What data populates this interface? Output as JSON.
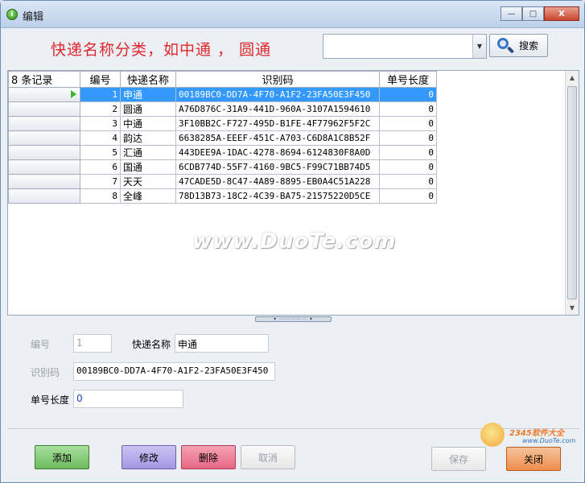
{
  "window": {
    "title": "编辑",
    "buttons": {
      "minimize": "—",
      "maximize": "□",
      "close": "X"
    }
  },
  "headline": "快递名称分类，如中通 ， 圆通",
  "search": {
    "value": "",
    "placeholder": "",
    "button_label": "搜索"
  },
  "grid": {
    "record_count_label": "8 条记录",
    "columns": [
      "编号",
      "快递名称",
      "识别码",
      "单号长度"
    ],
    "rows": [
      {
        "num": "1",
        "name": "申通",
        "code": "00189BC0-DD7A-4F70-A1F2-23FA50E3F450",
        "len": "0"
      },
      {
        "num": "2",
        "name": "圆通",
        "code": "A76D876C-31A9-441D-960A-3107A1594610",
        "len": "0"
      },
      {
        "num": "3",
        "name": "中通",
        "code": "3F10BB2C-F727-495D-B1FE-4F77962F5F2C",
        "len": "0"
      },
      {
        "num": "4",
        "name": "韵达",
        "code": "6638285A-EEEF-451C-A703-C6D8A1C8B52F",
        "len": "0"
      },
      {
        "num": "5",
        "name": "汇通",
        "code": "443DEE9A-1DAC-4278-8694-6124830F8A0D",
        "len": "0"
      },
      {
        "num": "6",
        "name": "国通",
        "code": "6CDB774D-55F7-4160-9BC5-F99C71BB74D5",
        "len": "0"
      },
      {
        "num": "7",
        "name": "天天",
        "code": "47CADE5D-8C47-4A89-8895-EB0A4C51A228",
        "len": "0"
      },
      {
        "num": "8",
        "name": "全峰",
        "code": "78D13B73-18C2-4C39-BA75-21575220D5CE",
        "len": "0"
      }
    ]
  },
  "form": {
    "num_label": "编号",
    "num_value": "1",
    "name_label": "快递名称",
    "name_value": "申通",
    "code_label": "识别码",
    "code_value": "00189BC0-DD7A-4F70-A1F2-23FA50E3F450",
    "len_label": "单号长度",
    "len_value": "0"
  },
  "actions": {
    "add": "添加",
    "edit": "修改",
    "delete": "删除",
    "cancel": "取消",
    "save": "保存",
    "close": "关闭"
  },
  "watermark": "www.DuoTe.com",
  "corner_logo": {
    "brand": "2345软件大全",
    "url": "www.DuoTe.com"
  },
  "colors": {
    "headline": "#e0282d",
    "selection": "#3399ff",
    "add_button": "#6dbb5c",
    "edit_button": "#a397e3",
    "delete_button": "#e66885",
    "close_button": "#ef8d4c"
  }
}
